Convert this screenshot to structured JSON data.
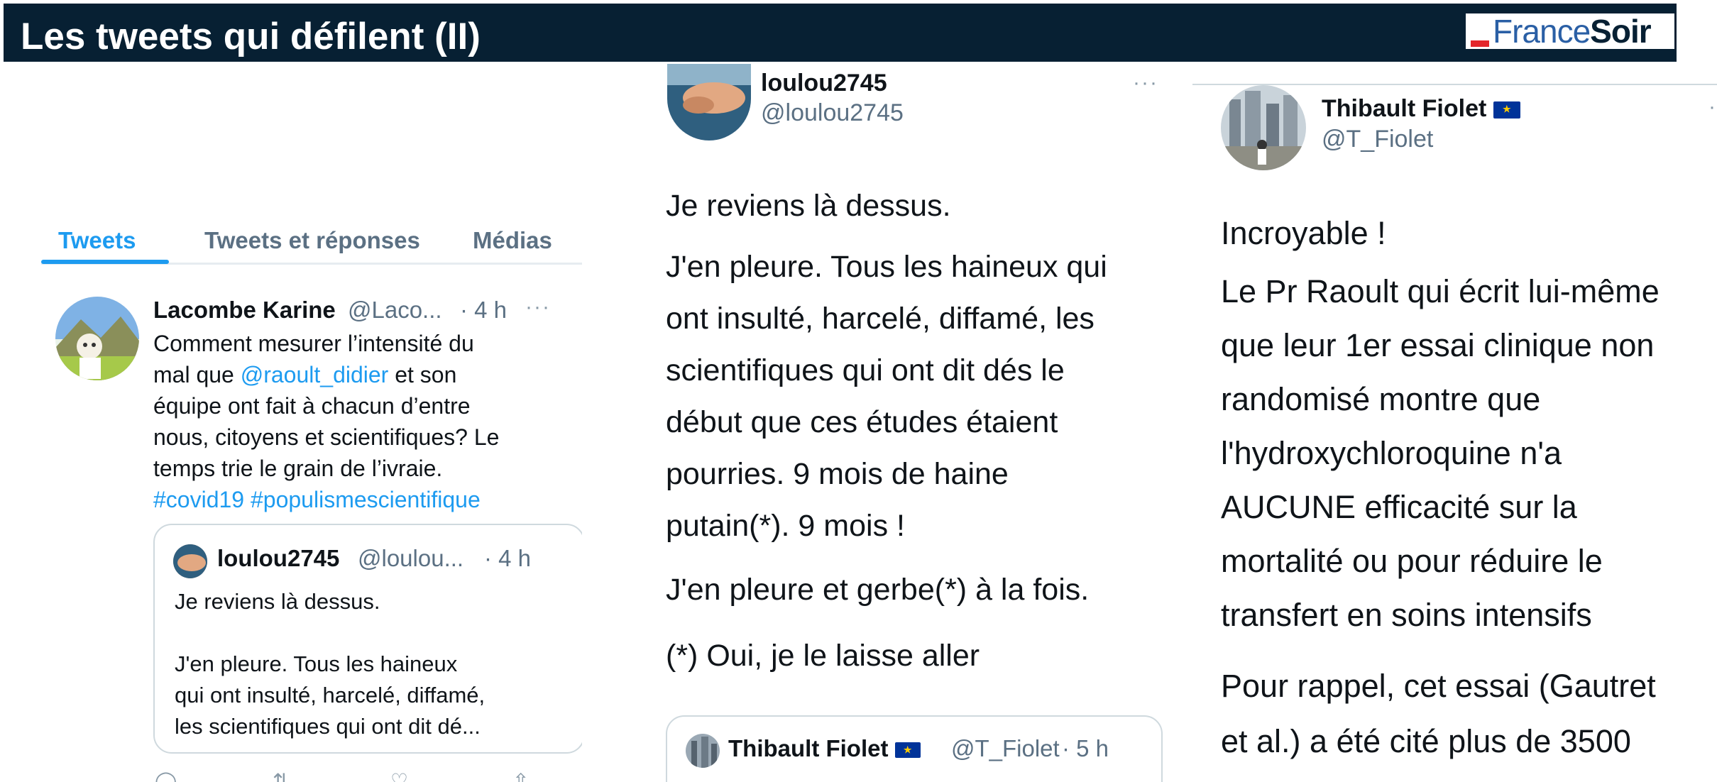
{
  "slide": {
    "title": "Les tweets qui défilent (II)",
    "logo": {
      "part1": "France",
      "part2": "Soir"
    }
  },
  "left": {
    "tabs": [
      {
        "label": "Tweets",
        "active": true
      },
      {
        "label": "Tweets et réponses",
        "active": false
      },
      {
        "label": "Médias",
        "active": false
      }
    ],
    "tweet": {
      "name": "Lacombe Karine",
      "handle": "@Laco...",
      "time": "· 4 h",
      "more": "···",
      "line1": "Comment mesurer l’intensité du",
      "line2_prefix": "mal que ",
      "mention": "@raoult_didier",
      "line2_suffix": " et son",
      "line3": "équipe ont fait à chacun d’entre",
      "line4": "nous, citoyens et scientifiques?  Le",
      "line5": "temps trie le grain de l’ivraie.",
      "hashtags": "#covid19 #populismescientifique"
    },
    "quote": {
      "name": "loulou2745",
      "handle": "@loulou...",
      "time": "· 4 h",
      "line1": "Je reviens là dessus.",
      "line2": "J'en pleure. Tous les haineux",
      "line3": "qui ont insulté, harcelé, diffamé,",
      "line4": "les scientifiques qui ont dit dé..."
    }
  },
  "middle": {
    "name": "loulou2745",
    "handle": "@loulou2745",
    "more": "···",
    "para1": "Je reviens là dessus.",
    "para2": "J'en pleure. Tous les haineux qui\nont insulté, harcelé, diffamé, les\nscientifiques qui ont dit dés le\ndébut que ces études étaient\npourries. 9 mois de haine\nputain(*). 9 mois !",
    "para3": "J'en pleure et gerbe(*) à la fois.",
    "para4": "(*) Oui, je le laisse aller",
    "quote": {
      "name": "Thibault Fiolet",
      "handle": "@T_Fiolet",
      "time": "· 5 h"
    }
  },
  "right": {
    "name": "Thibault Fiolet",
    "handle": "@T_Fiolet",
    "para1": "Incroyable !",
    "para2": "Le Pr Raoult qui écrit lui-même\nque leur 1er essai clinique non\nrandomisé montre que\nl'hydroxychloroquine n'a\nAUCUNE efficacité sur la\nmortalité ou pour réduire le\ntransfert en soins intensifs",
    "para3": "Pour rappel, cet essai (Gautret\net al.) a été cité plus de 3500"
  },
  "colors": {
    "banner": "#072033",
    "accent": "#1d9bf0",
    "logo_red": "#e3262b",
    "eu_flag": "#003399"
  },
  "icons": [
    "reply-icon",
    "retweet-icon",
    "like-icon",
    "share-icon",
    "eu-flag-icon",
    "more-icon"
  ]
}
